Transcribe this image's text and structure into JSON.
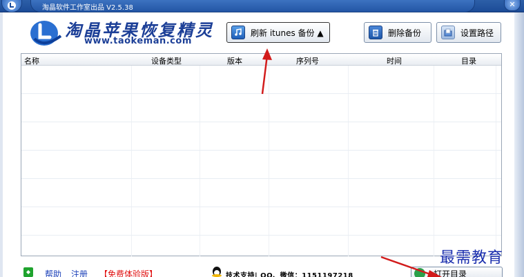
{
  "window": {
    "title": "淘晶软件工作室出品 V2.5.38",
    "close_glyph": "✕"
  },
  "header": {
    "logo_icon": "taokeman-logo-icon",
    "title": "淘晶苹果恢复精灵",
    "url": "www.taokeman.com"
  },
  "toolbar": {
    "refresh_label": "刷新 itunes 备份 ▲",
    "delete_label": "删除备份",
    "path_label": "设置路径",
    "icons": [
      "music-icon",
      "trash-icon",
      "folder-icon"
    ]
  },
  "table": {
    "columns": [
      "名称",
      "设备类型",
      "版本",
      "序列号",
      "时间",
      "目录"
    ],
    "rows": []
  },
  "footer": {
    "help_label": "帮助",
    "register_label": "注册",
    "trial_label": "【免费体验版】",
    "support_label": "技术支持| QQ、微信：1151197218",
    "open_dir_label": "打开目录"
  },
  "watermark": "最需教育",
  "colors": {
    "title_bar": "#2356a5",
    "logo_text": "#1c3f97",
    "link": "#1a3fb8",
    "trial": "#e01010",
    "arrow": "#d21b1b"
  }
}
